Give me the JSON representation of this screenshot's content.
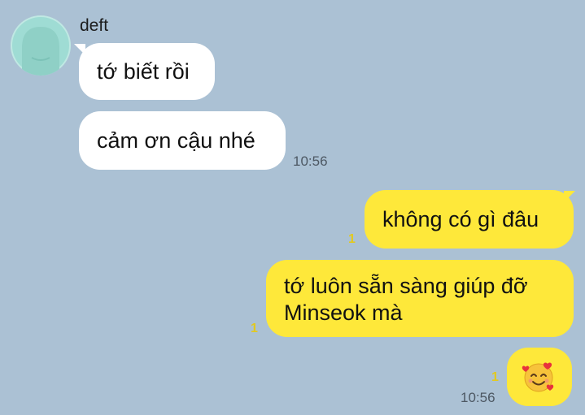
{
  "conversation": {
    "sender_name": "deft",
    "messages": [
      {
        "side": "incoming",
        "text": "tớ biết rồi"
      },
      {
        "side": "incoming",
        "text": "cảm ơn cậu nhé",
        "time": "10:56"
      },
      {
        "side": "outgoing",
        "text": "không có gì đâu",
        "unread": "1"
      },
      {
        "side": "outgoing",
        "lines": [
          "tớ luôn sẵn sàng giúp đỡ",
          "Minseok mà"
        ],
        "unread": "1"
      },
      {
        "side": "outgoing",
        "emoji": "smiling-face-with-hearts",
        "unread": "1",
        "time": "10:56"
      }
    ]
  },
  "colors": {
    "background": "#abc1d4",
    "incoming_bubble": "#ffffff",
    "outgoing_bubble": "#fee83a",
    "unread_count": "#e2c91f"
  }
}
